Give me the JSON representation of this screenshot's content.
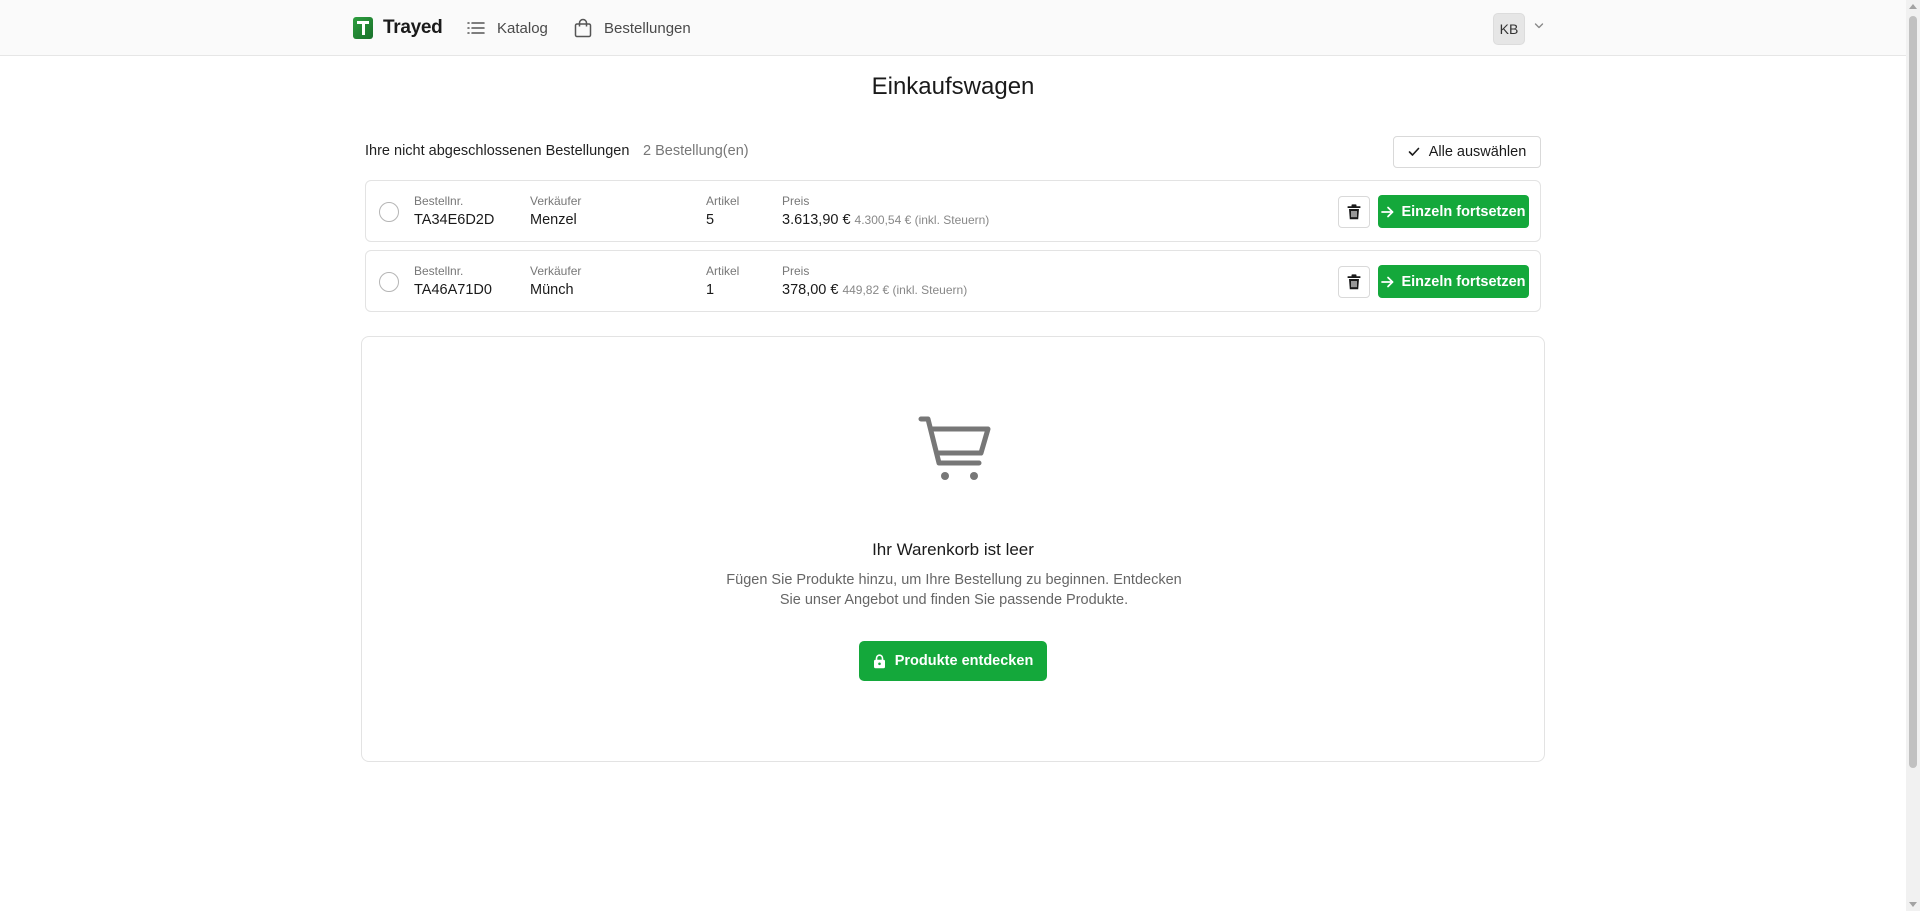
{
  "header": {
    "brand": "Trayed",
    "nav": [
      {
        "label": "Katalog",
        "icon": "list-icon"
      },
      {
        "label": "Bestellungen",
        "icon": "shopping-bag-icon"
      }
    ],
    "user_initials": "KB"
  },
  "page": {
    "title": "Einkaufswagen"
  },
  "orders_section": {
    "title": "Ihre nicht abgeschlossenen Bestellungen",
    "count": "2 Bestellung(en)",
    "select_all_label": "Alle auswählen",
    "labels": {
      "order_no": "Bestellnr.",
      "seller": "Verkäufer",
      "items": "Artikel",
      "price": "Preis"
    },
    "continue_label": "Einzeln fortsetzen",
    "orders": [
      {
        "order_no": "TA34E6D2D",
        "seller": "Menzel",
        "items": "5",
        "price": "3.613,90 €",
        "price_incl": "4.300,54 € (inkl. Steuern)"
      },
      {
        "order_no": "TA46A71D0",
        "seller": "Münch",
        "items": "1",
        "price": "378,00 €",
        "price_incl": "449,82 € (inkl. Steuern)"
      }
    ]
  },
  "empty_state": {
    "icon": "shopping-cart-icon",
    "title": "Ihr Warenkorb ist leer",
    "description": "Fügen Sie Produkte hinzu, um Ihre Bestellung zu beginnen. Entdecken Sie unser Angebot und finden Sie passende Produkte.",
    "button_label": "Produkte entdecken"
  },
  "colors": {
    "primary_green": "#14a83b",
    "header_bg": "#fafafa",
    "border": "#e3e3e3"
  }
}
